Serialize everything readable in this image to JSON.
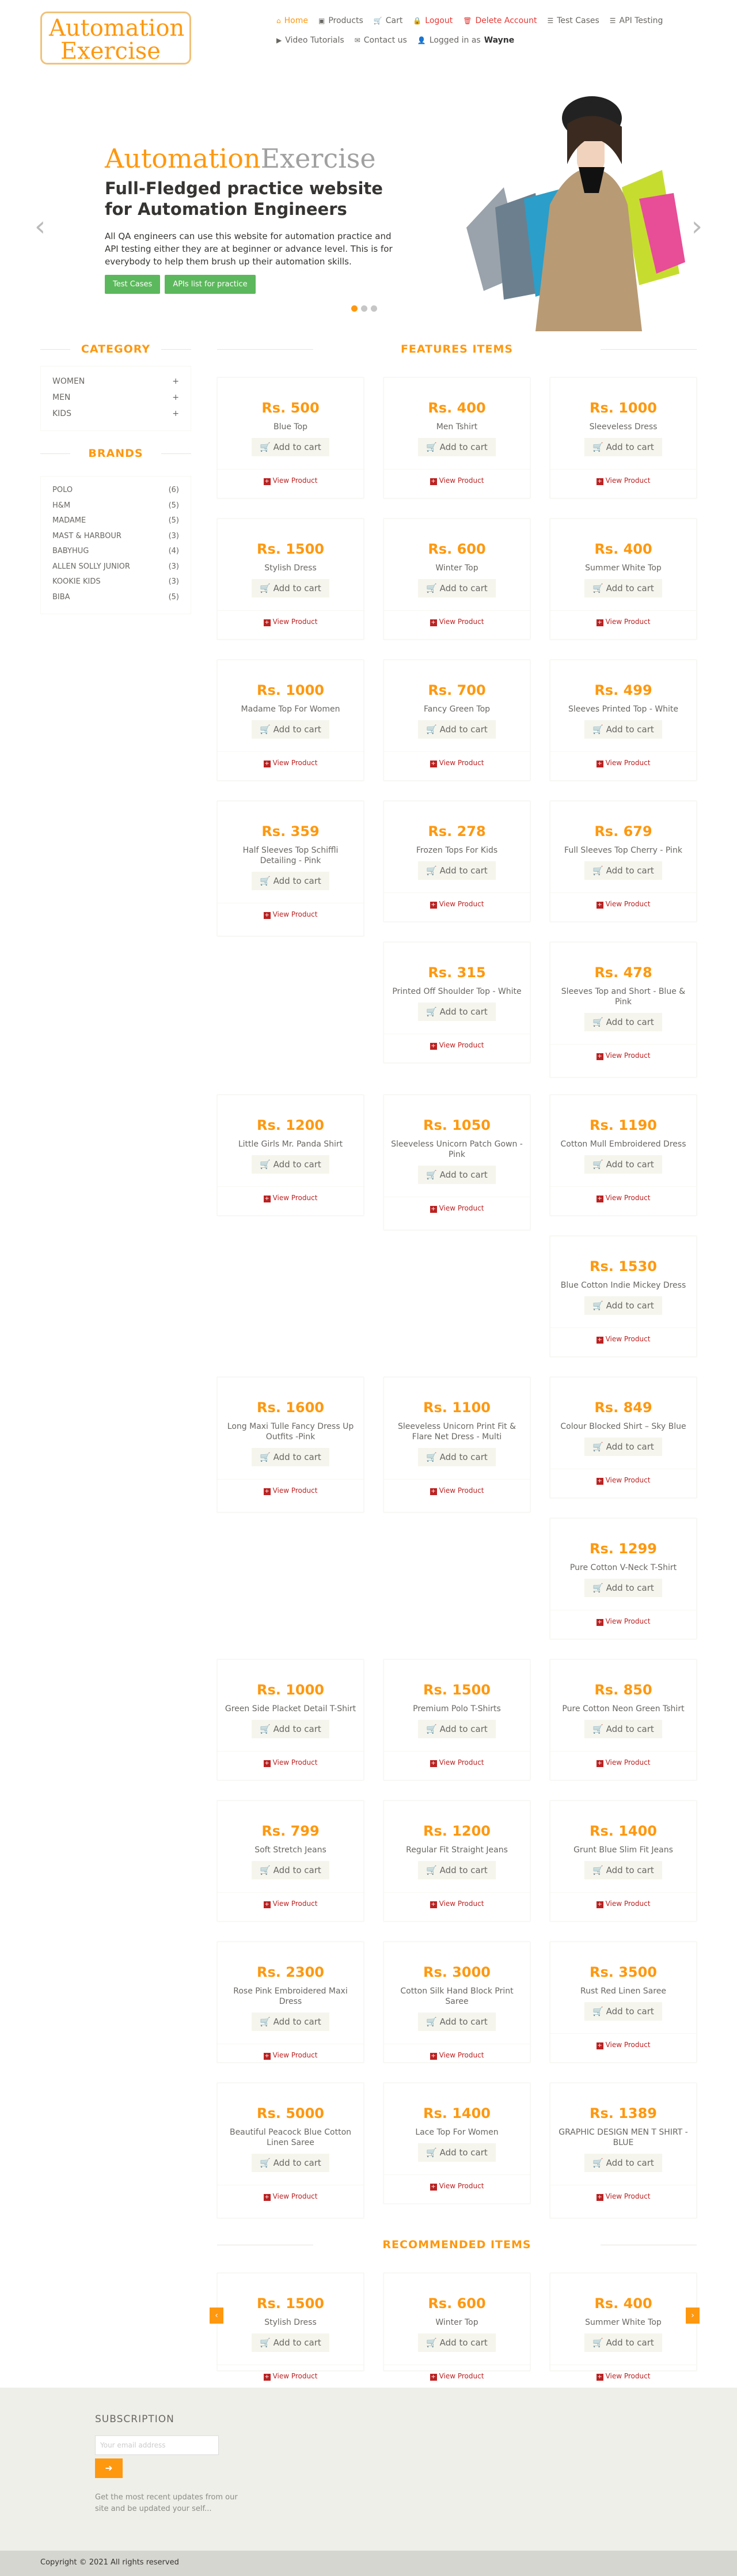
{
  "header": {
    "logo_a": "Automation",
    "logo_b": "Exercise",
    "nav": [
      {
        "label": "Home",
        "icon": "home-icon"
      },
      {
        "label": "Products",
        "icon": "products-icon"
      },
      {
        "label": "Cart",
        "icon": "cart-icon"
      },
      {
        "label": "Logout",
        "icon": "lock-icon"
      },
      {
        "label": "Delete Account",
        "icon": "trash-icon"
      },
      {
        "label": "Test Cases",
        "icon": "list-icon"
      },
      {
        "label": "API Testing",
        "icon": "list-icon"
      },
      {
        "label": "Video Tutorials",
        "icon": "youtube-icon"
      },
      {
        "label": "Contact us",
        "icon": "envelope-icon"
      }
    ],
    "logged_in_prefix": "Logged in as",
    "logged_in_user": "Wayne"
  },
  "slider": {
    "brand_a": "Automation",
    "brand_b": "Exercise",
    "heading": "Full-Fledged practice website for Automation Engineers",
    "text": "All QA engineers can use this website for automation practice and API testing either they are at beginner or advance level. This is for everybody to help them brush up their automation skills.",
    "btn_test_cases": "Test Cases",
    "btn_apis": "APIs list for practice",
    "prev": "‹",
    "next": "›"
  },
  "sidebar": {
    "category_title": "CATEGORY",
    "categories": [
      "WOMEN",
      "MEN",
      "KIDS"
    ],
    "brands_title": "BRANDS",
    "brands": [
      {
        "name": "POLO",
        "count": "(6)"
      },
      {
        "name": "H&M",
        "count": "(5)"
      },
      {
        "name": "MADAME",
        "count": "(5)"
      },
      {
        "name": "MAST & HARBOUR",
        "count": "(3)"
      },
      {
        "name": "BABYHUG",
        "count": "(4)"
      },
      {
        "name": "ALLEN SOLLY JUNIOR",
        "count": "(3)"
      },
      {
        "name": "KOOKIE KIDS",
        "count": "(3)"
      },
      {
        "name": "BIBA",
        "count": "(5)"
      }
    ]
  },
  "features_title": "FEATURES ITEMS",
  "add_to_cart": "Add to cart",
  "view_product": "View Product",
  "products": [
    {
      "price": "Rs. 500",
      "name": "Blue Top"
    },
    {
      "price": "Rs. 400",
      "name": "Men Tshirt"
    },
    {
      "price": "Rs. 1000",
      "name": "Sleeveless Dress"
    },
    {
      "price": "Rs. 1500",
      "name": "Stylish Dress"
    },
    {
      "price": "Rs. 600",
      "name": "Winter Top"
    },
    {
      "price": "Rs. 400",
      "name": "Summer White Top"
    },
    {
      "price": "Rs. 1000",
      "name": "Madame Top For Women"
    },
    {
      "price": "Rs. 700",
      "name": "Fancy Green Top"
    },
    {
      "price": "Rs. 499",
      "name": "Sleeves Printed Top - White"
    },
    {
      "price": "Rs. 359",
      "name": "Half Sleeves Top Schiffli Detailing - Pink"
    },
    {
      "price": "Rs. 278",
      "name": "Frozen Tops For Kids"
    },
    {
      "price": "Rs. 679",
      "name": "Full Sleeves Top Cherry - Pink"
    },
    {
      "price": "Rs. 315",
      "name": "Printed Off Shoulder Top - White"
    },
    {
      "price": "Rs. 478",
      "name": "Sleeves Top and Short - Blue & Pink"
    },
    {
      "price": "Rs. 1200",
      "name": "Little Girls Mr. Panda Shirt"
    },
    {
      "price": "Rs. 1050",
      "name": "Sleeveless Unicorn Patch Gown - Pink"
    },
    {
      "price": "Rs. 1190",
      "name": "Cotton Mull Embroidered Dress"
    },
    {
      "price": "Rs. 1530",
      "name": "Blue Cotton Indie Mickey Dress"
    },
    {
      "price": "Rs. 1600",
      "name": "Long Maxi Tulle Fancy Dress Up Outfits -Pink"
    },
    {
      "price": "Rs. 1100",
      "name": "Sleeveless Unicorn Print Fit & Flare Net Dress - Multi"
    },
    {
      "price": "Rs. 849",
      "name": "Colour Blocked Shirt – Sky Blue"
    },
    {
      "price": "Rs. 1299",
      "name": "Pure Cotton V-Neck T-Shirt"
    },
    {
      "price": "Rs. 1000",
      "name": "Green Side Placket Detail T-Shirt"
    },
    {
      "price": "Rs. 1500",
      "name": "Premium Polo T-Shirts"
    },
    {
      "price": "Rs. 850",
      "name": "Pure Cotton Neon Green Tshirt"
    },
    {
      "price": "Rs. 799",
      "name": "Soft Stretch Jeans"
    },
    {
      "price": "Rs. 1200",
      "name": "Regular Fit Straight Jeans"
    },
    {
      "price": "Rs. 1400",
      "name": "Grunt Blue Slim Fit Jeans"
    },
    {
      "price": "Rs. 2300",
      "name": "Rose Pink Embroidered Maxi Dress"
    },
    {
      "price": "Rs. 3000",
      "name": "Cotton Silk Hand Block Print Saree"
    },
    {
      "price": "Rs. 3500",
      "name": "Rust Red Linen Saree"
    },
    {
      "price": "Rs. 5000",
      "name": "Beautiful Peacock Blue Cotton Linen Saree"
    },
    {
      "price": "Rs. 1400",
      "name": "Lace Top For Women"
    },
    {
      "price": "Rs. 1389",
      "name": "GRAPHIC DESIGN MEN T SHIRT - BLUE"
    }
  ],
  "recommended_title": "RECOMMENDED ITEMS",
  "recommended": [
    {
      "price": "Rs. 1500",
      "name": "Stylish Dress"
    },
    {
      "price": "Rs. 600",
      "name": "Winter Top"
    },
    {
      "price": "Rs. 400",
      "name": "Summer White Top"
    }
  ],
  "footer": {
    "subscription_title": "SUBSCRIPTION",
    "email_placeholder": "Your email address",
    "subscribe_text": "Get the most recent updates from our site and be updated your self...",
    "copyright": "Copyright © 2021 All rights reserved"
  },
  "colors": {
    "accent": "#FE980F",
    "green": "#5CB85C",
    "footer_bg": "#EFEFE9"
  }
}
